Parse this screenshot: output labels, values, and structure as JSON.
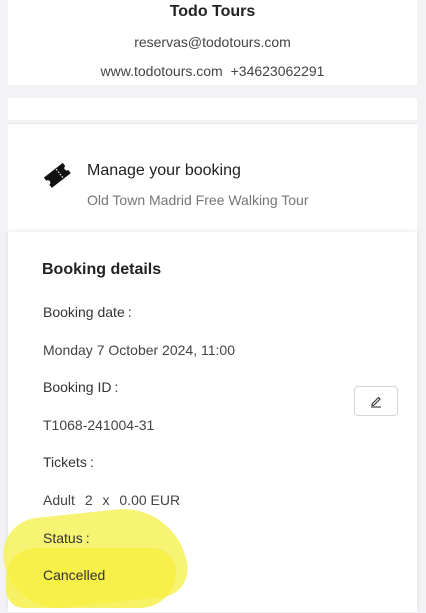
{
  "company": {
    "name": "Todo Tours",
    "email": "reservas@todotours.com",
    "website": "www.todotours.com",
    "phone": "+34623062291"
  },
  "manage": {
    "title": "Manage your booking",
    "tour": "Old Town Madrid Free Walking Tour",
    "icon": "ticket-icon"
  },
  "details": {
    "title": "Booking details",
    "booking_date_label": "Booking date",
    "booking_date": "Monday 7 October 2024, 11:00",
    "booking_id_label": "Booking ID",
    "booking_id": "T1068-241004-31",
    "tickets_label": "Tickets",
    "ticket_type": "Adult",
    "ticket_qty": "2",
    "ticket_x": "x",
    "ticket_price": "0.00 EUR",
    "status_label": "Status",
    "status": "Cancelled",
    "colon": ":"
  },
  "colors": {
    "highlight": "#f7f25a",
    "background": "#f3f3f5"
  }
}
